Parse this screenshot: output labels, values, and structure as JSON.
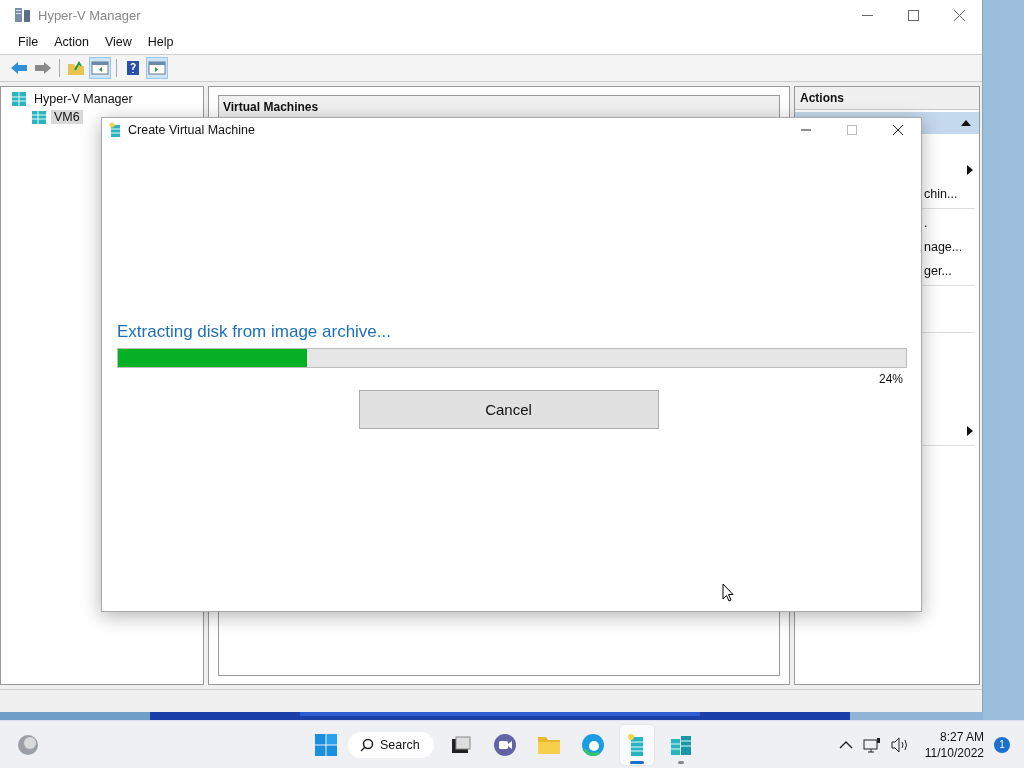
{
  "window": {
    "title": "Hyper-V Manager"
  },
  "menu": [
    {
      "label": "File"
    },
    {
      "label": "Action"
    },
    {
      "label": "View"
    },
    {
      "label": "Help"
    }
  ],
  "toolbar": [
    [
      {
        "kind": "back",
        "pressed": false
      },
      {
        "kind": "forward",
        "pressed": false
      }
    ],
    [
      {
        "kind": "folder",
        "pressed": false
      },
      {
        "kind": "tree",
        "pressed": true
      }
    ],
    [
      {
        "kind": "help",
        "pressed": false
      },
      {
        "kind": "pane",
        "pressed": true
      }
    ]
  ],
  "tree": [
    {
      "label": "Hyper-V Manager",
      "selected": false,
      "children": [
        {
          "label": "VM6",
          "selected": true
        }
      ]
    }
  ],
  "center": {
    "title": "Virtual Machines"
  },
  "actions": {
    "title": "Actions",
    "items": [
      {
        "kind": "arrow"
      },
      {
        "kind": "text",
        "label": "chin..."
      },
      {
        "kind": "rule"
      },
      {
        "kind": "text",
        "label": "."
      },
      {
        "kind": "text",
        "label": "nage..."
      },
      {
        "kind": "text",
        "label": "ger..."
      },
      {
        "kind": "rule"
      },
      {
        "kind": "gap"
      },
      {
        "kind": "rule"
      },
      {
        "kind": "gap"
      },
      {
        "kind": "gap"
      },
      {
        "kind": "arrow"
      },
      {
        "kind": "rule"
      }
    ]
  },
  "dialog": {
    "title": "Create Virtual Machine",
    "message": "Extracting disk from image archive...",
    "progress": {
      "level": 0.24,
      "reading": "24%"
    },
    "button": "Cancel"
  },
  "taskbar": {
    "search": "Search",
    "apps": [
      {
        "kind": "taskview",
        "selected": false,
        "running": false
      },
      {
        "kind": "chat",
        "selected": false,
        "running": false
      },
      {
        "kind": "folder",
        "selected": false,
        "running": false
      },
      {
        "kind": "edge",
        "selected": false,
        "running": false
      },
      {
        "kind": "hyperv",
        "selected": true,
        "running": true
      },
      {
        "kind": "server",
        "selected": false,
        "running": true
      }
    ],
    "time": "8:27 AM",
    "date": "11/10/2022",
    "badge": "1"
  }
}
